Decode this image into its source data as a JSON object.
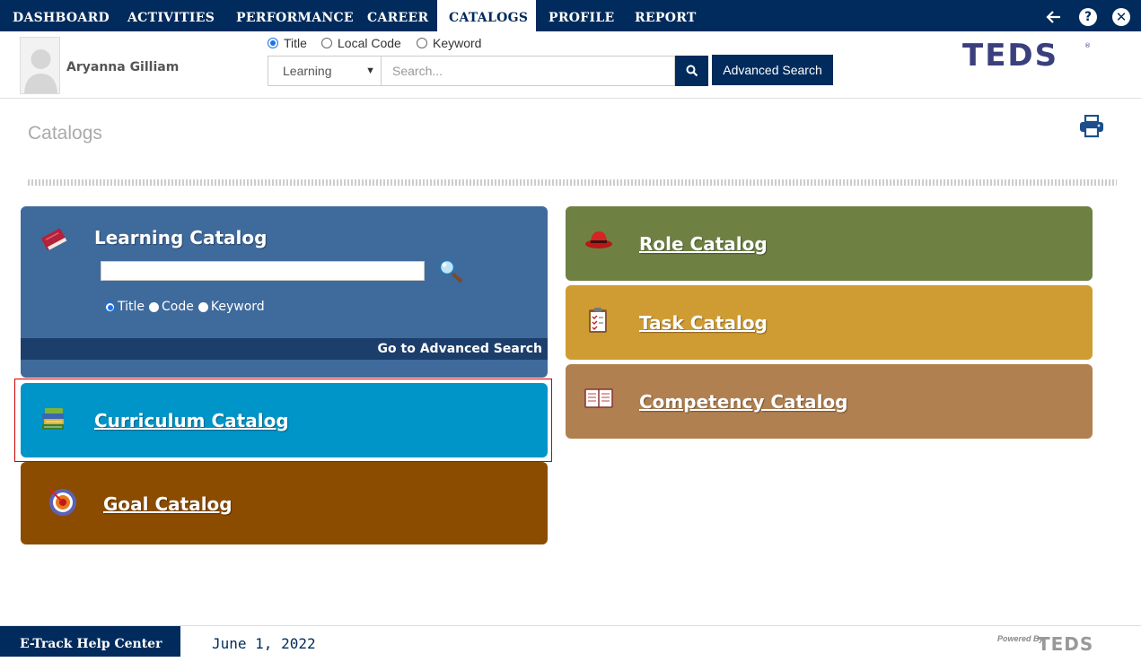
{
  "nav": {
    "items": [
      "DASHBOARD",
      "ACTIVITIES",
      "PERFORMANCE",
      "CAREER",
      "CATALOGS",
      "PROFILE",
      "REPORT"
    ],
    "active": "CATALOGS",
    "icons": [
      "back-arrow-icon",
      "help-icon",
      "close-icon"
    ]
  },
  "header": {
    "user_name": "Aryanna Gilliam",
    "search_modes": [
      "Title",
      "Local Code",
      "Keyword"
    ],
    "search_mode_selected": "Title",
    "category_selected": "Learning",
    "search_placeholder": "Search...",
    "advanced_search_label": "Advanced Search",
    "logo_text": "TEDS"
  },
  "page": {
    "title": "Catalogs"
  },
  "catalogs": {
    "learning": {
      "title": "Learning Catalog",
      "search_value": "",
      "modes": [
        "Title",
        "Code",
        "Keyword"
      ],
      "mode_selected": "Title",
      "advanced_link": "Go to Advanced Search",
      "color": "#3f6a9c"
    },
    "curriculum": {
      "title": "Curriculum Catalog",
      "color": "#0095c8"
    },
    "goal": {
      "title": "Goal Catalog",
      "color": "#8b4c00"
    },
    "role": {
      "title": "Role Catalog",
      "color": "#6f8043"
    },
    "task": {
      "title": "Task Catalog",
      "color": "#cf9b33"
    },
    "competency": {
      "title": "Competency Catalog",
      "color": "#b08050"
    }
  },
  "footer": {
    "help_center": "E-Track Help Center",
    "date": "June 1, 2022",
    "powered_by": "Powered By",
    "powered_logo": "TEDS"
  }
}
